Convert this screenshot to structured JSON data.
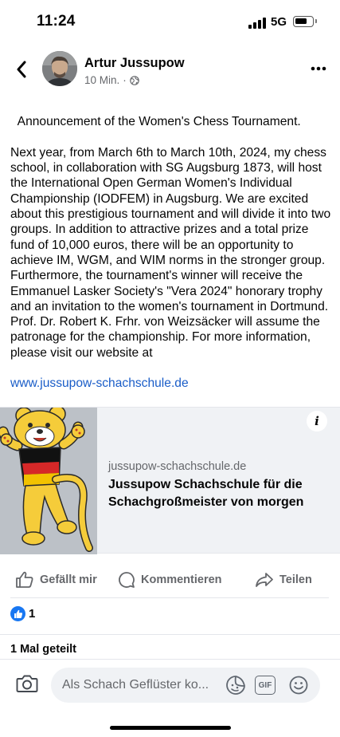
{
  "status_bar": {
    "time": "11:24",
    "network": "5G",
    "battery_level": 0.75
  },
  "post": {
    "author": "Artur Jussupow",
    "time_ago": "10 Min.",
    "separator": "·",
    "audience_icon": "globe-icon",
    "text": "Announcement of the Women's Chess Tournament.\n\nNext year, from March 6th to March 10th, 2024, my chess school, in collaboration with SG Augsburg 1873, will host the International Open German Women's Individual Championship (IODFEM) in Augsburg. We are excited about this prestigious tournament and will divide it into two groups. In addition to attractive prizes and a total prize fund of 10,000 euros, there will be an opportunity to achieve IM, WGM, and WIM norms in the stronger group. Furthermore, the tournament's winner will receive the Emmanuel Lasker Society's \"Vera 2024\" honorary trophy and an invitation to the women's tournament in Dortmund. Prof. Dr. Robert K. Frhr. von Weizsäcker will assume the patronage for the championship. For more information, please visit our website at",
    "link_text": "www.jussupow-schachschule.de",
    "link_accent": "#1a5dc8"
  },
  "link_preview": {
    "info_label": "i",
    "domain": "jussupow-schachschule.de",
    "title": "Jussupow Schachschule für die Schachgroßmeister von morgen"
  },
  "actions": {
    "like_label": "Gefällt mir",
    "comment_label": "Kommentieren",
    "share_label": "Teilen"
  },
  "engagement": {
    "reaction_count": "1",
    "reaction_icon": "like-reaction-icon",
    "reaction_color": "#1877f2",
    "shares_label": "1 Mal geteilt"
  },
  "comment_composer": {
    "placeholder": "Als Schach Geflüster ko...",
    "gif_label": "GIF"
  }
}
